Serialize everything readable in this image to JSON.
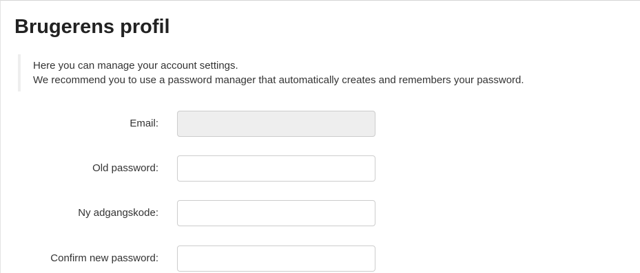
{
  "page": {
    "title": "Brugerens profil"
  },
  "intro": {
    "line1": "Here you can manage your account settings.",
    "line2": "We recommend you to use a password manager that automatically creates and remembers your password."
  },
  "form": {
    "email": {
      "label": "Email:",
      "value": ""
    },
    "old_password": {
      "label": "Old password:",
      "value": ""
    },
    "new_password": {
      "label": "Ny adgangskode:",
      "value": ""
    },
    "confirm_password": {
      "label": "Confirm new password:",
      "value": ""
    }
  }
}
